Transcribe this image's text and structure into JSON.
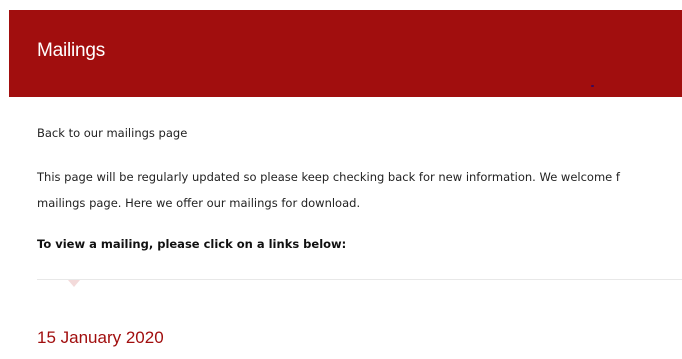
{
  "header": {
    "title": "Mailings",
    "background_color": "#a10e0e",
    "text_color": "#ffffff"
  },
  "content": {
    "back_link": "Back to our mailings page",
    "intro_line_1": "This page will be regularly updated so please keep checking back for new information. We welcome f",
    "intro_line_2": "mailings page. Here we offer our mailings for download.",
    "instruction": "To view a mailing, please click on a links below:"
  },
  "mailings": [
    {
      "date": "15 January 2020",
      "color": "#a10e0e"
    }
  ]
}
